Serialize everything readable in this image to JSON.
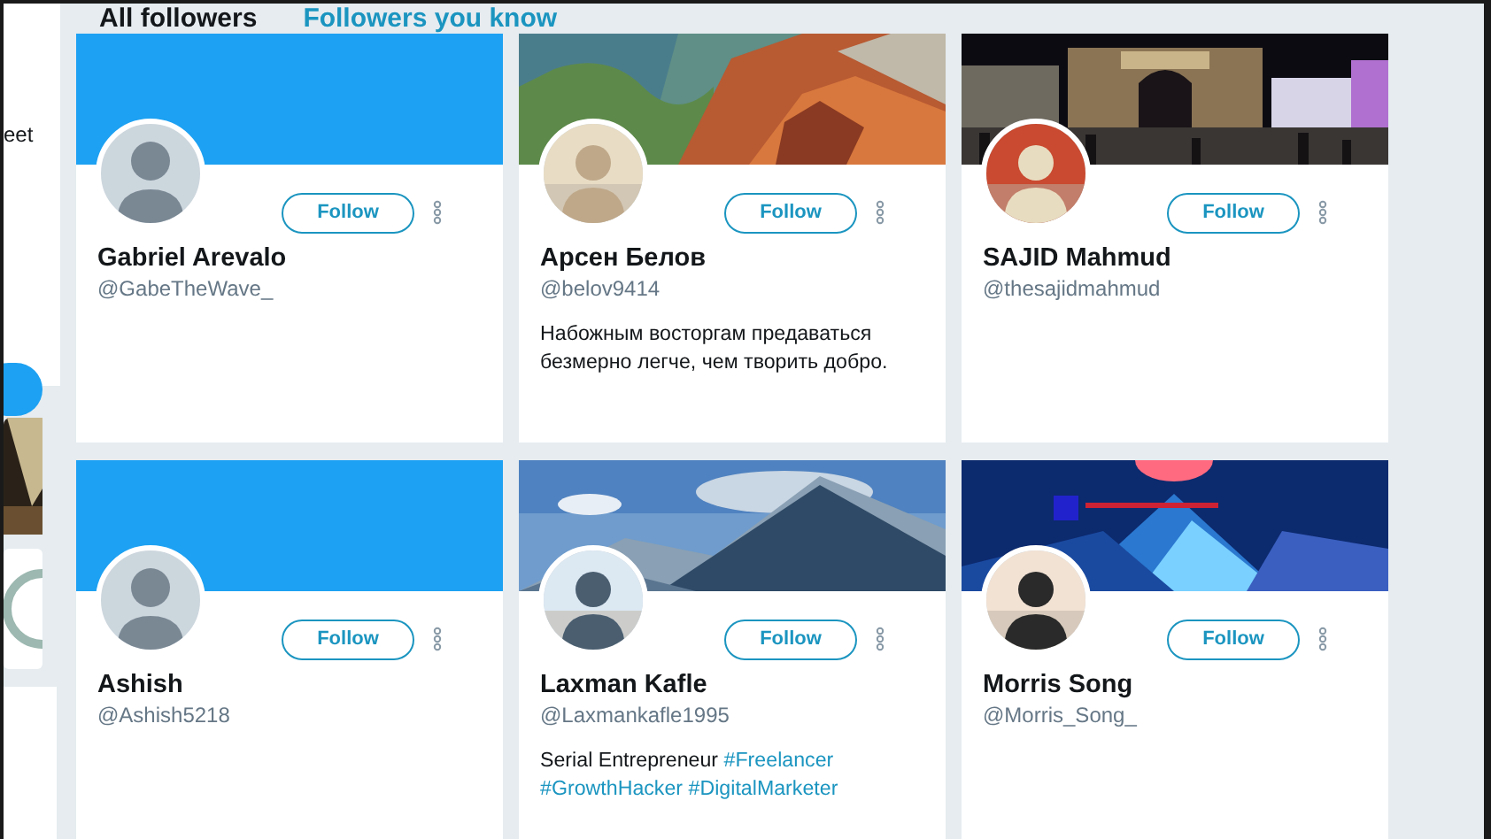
{
  "sidebar": {
    "partial_text": "eet"
  },
  "tabs": [
    {
      "label": "All followers",
      "selected": true
    },
    {
      "label": "Followers you know",
      "selected": false
    }
  ],
  "followers": [
    {
      "name": "Gabriel Arevalo",
      "handle": "@GabeTheWave_",
      "banner": {
        "kind": "plain"
      },
      "avatar": {
        "kind": "default"
      },
      "follow_label": "Follow"
    },
    {
      "name": "Арсен Белов",
      "handle": "@belov9414",
      "banner": {
        "kind": "picture"
      },
      "avatar": {
        "kind": "picture"
      },
      "follow_label": "Follow",
      "bio": [
        {
          "kind": "text",
          "text": "Набожным восторгам предаваться безмерно легче, чем творить добро."
        }
      ]
    },
    {
      "name": "SAJID Mahmud",
      "handle": "@thesajidmahmud",
      "banner": {
        "kind": "picture"
      },
      "avatar": {
        "kind": "picture"
      },
      "follow_label": "Follow"
    },
    {
      "name": "Ashish",
      "handle": "@Ashish5218",
      "banner": {
        "kind": "plain"
      },
      "avatar": {
        "kind": "default"
      },
      "follow_label": "Follow"
    },
    {
      "name": "Laxman Kafle",
      "handle": "@Laxmankafle1995",
      "banner": {
        "kind": "picture"
      },
      "avatar": {
        "kind": "picture"
      },
      "follow_label": "Follow",
      "bio": [
        {
          "kind": "text",
          "text": "Serial Entrepreneur"
        },
        {
          "kind": "hashtag",
          "text": "#Freelancer"
        },
        {
          "kind": "hashtag",
          "text": "#GrowthHacker"
        },
        {
          "kind": "hashtag",
          "text": "#DigitalMarketer"
        }
      ]
    },
    {
      "name": "Morris Song",
      "handle": "@Morris_Song_",
      "banner": {
        "kind": "picture"
      },
      "avatar": {
        "kind": "picture"
      },
      "follow_label": "Follow"
    }
  ]
}
